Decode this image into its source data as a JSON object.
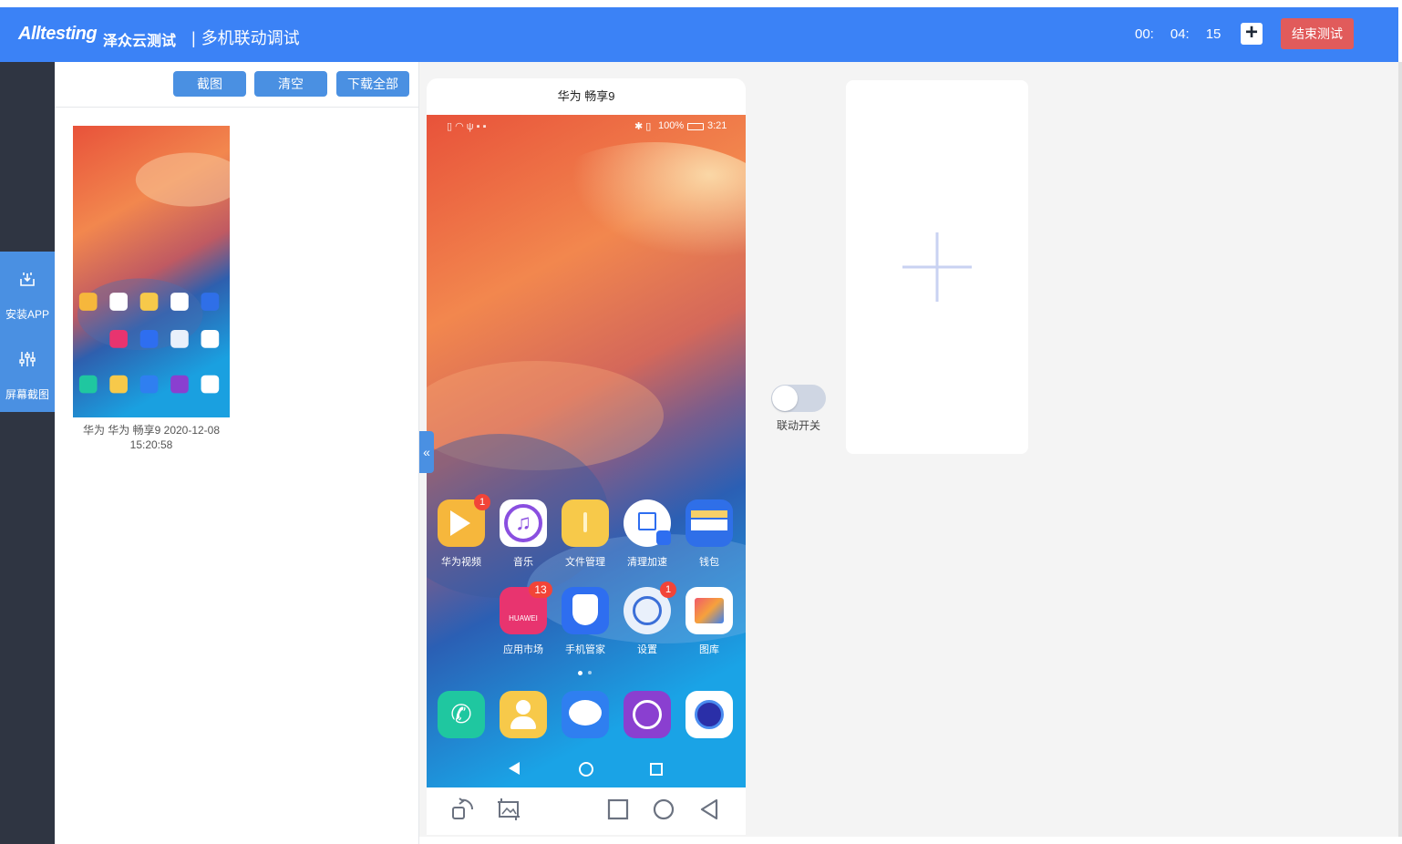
{
  "header": {
    "brand_en": "Alltesting",
    "brand_cn": "泽众云测试",
    "title": "多机联动调试",
    "timer": {
      "hh": "00:",
      "mm": "04:",
      "ss": "15"
    },
    "add_symbol": "+",
    "end_test_label": "结束测试"
  },
  "rail": {
    "items": [
      {
        "label": "安装APP",
        "icon": "install-app-icon"
      },
      {
        "label": "屏幕截图",
        "icon": "screenshot-settings-icon"
      }
    ]
  },
  "screenshot_panel": {
    "buttons": {
      "capture": "截图",
      "clear": "清空",
      "download_all": "下载全部"
    },
    "items": [
      {
        "caption_line1": "华为 华为 畅享9  2020-12-08",
        "caption_line2": "15:20:58"
      }
    ]
  },
  "device": {
    "name": "华为 畅享9",
    "status_bar": {
      "battery": "100%",
      "time": "3:21"
    },
    "apps_row1": [
      {
        "label": "华为视频",
        "badge": "1",
        "color": "#f6b73c"
      },
      {
        "label": "音乐",
        "badge": "",
        "color": "#ffffff"
      },
      {
        "label": "文件管理",
        "badge": "",
        "color": "#f7c94a"
      },
      {
        "label": "清理加速",
        "badge": "",
        "color": "#ffffff"
      },
      {
        "label": "钱包",
        "badge": "",
        "color": "#2f6fe8"
      }
    ],
    "apps_row2": [
      {
        "label": "应用市场",
        "badge": "13",
        "color": "#e8346f"
      },
      {
        "label": "手机管家",
        "badge": "",
        "color": "#2e6ef0"
      },
      {
        "label": "设置",
        "badge": "1",
        "color": "#e9f0fb"
      },
      {
        "label": "图库",
        "badge": "",
        "color": "#ffffff"
      }
    ],
    "dock": [
      {
        "name": "phone-app-icon",
        "color": "#1fc7a0"
      },
      {
        "name": "contacts-app-icon",
        "color": "#f7c94a"
      },
      {
        "name": "messages-app-icon",
        "color": "#2f7ff0"
      },
      {
        "name": "browser-app-icon",
        "color": "#8a3fd0"
      },
      {
        "name": "camera-app-icon",
        "color": "#ffffff"
      }
    ],
    "controls": [
      "rotate-icon",
      "crop-screenshot-icon",
      "recent-apps-icon",
      "home-icon",
      "back-icon"
    ]
  },
  "sync_toggle": {
    "label": "联动开关",
    "on": false
  },
  "add_device": {
    "symbol": "+"
  }
}
